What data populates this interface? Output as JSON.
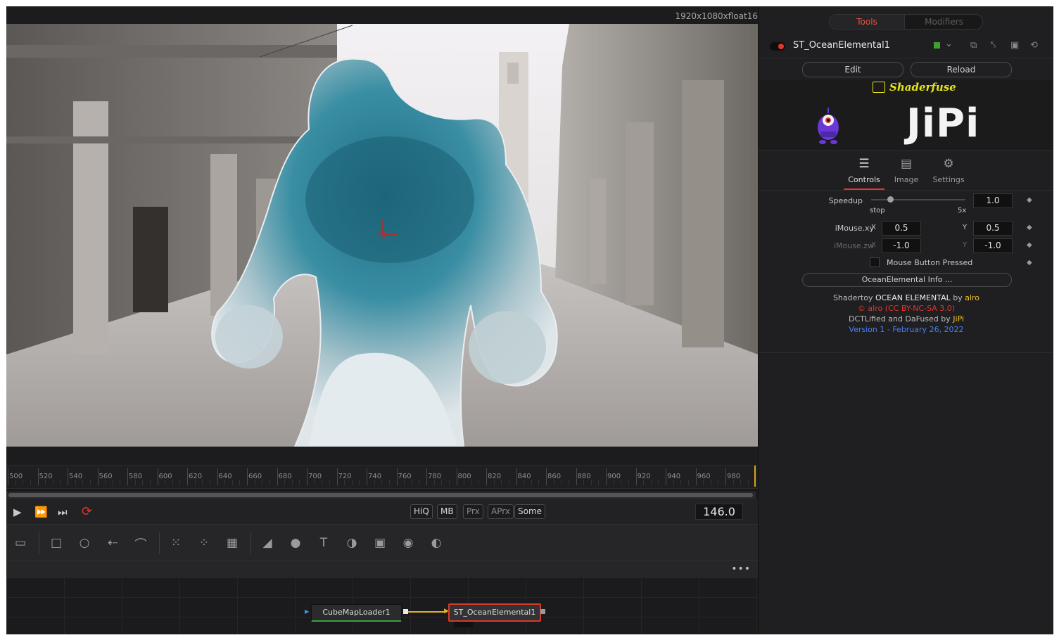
{
  "viewer": {
    "resolution": "1920x1080xfloat16"
  },
  "timeline": {
    "ticks": [
      "500",
      "520",
      "540",
      "560",
      "580",
      "600",
      "620",
      "640",
      "660",
      "680",
      "700",
      "720",
      "740",
      "760",
      "780",
      "800",
      "820",
      "840",
      "860",
      "880",
      "900",
      "920",
      "940",
      "960",
      "980"
    ],
    "current_frame": "146.0",
    "quality_buttons": [
      "HiQ",
      "MB",
      "Prx",
      "APrx",
      "Some"
    ]
  },
  "toolbar": {
    "icons": [
      "background-icon",
      "rectangle-icon",
      "ellipse-icon",
      "polygon-icon",
      "bspline-icon",
      "particle-emitter-icon",
      "particle-render-icon",
      "particle-icon",
      "image-plane-icon",
      "shape-3d-icon",
      "text-3d-icon",
      "merge-3d-icon",
      "renderer-3d-icon",
      "camera-3d-icon",
      "light-3d-icon"
    ]
  },
  "flow": {
    "more": "•••",
    "nodes": {
      "cubemap": "CubeMapLoader1",
      "ocean": "ST_OceanElemental1"
    }
  },
  "panel": {
    "tabs": {
      "tools": "Tools",
      "modifiers": "Modifiers"
    },
    "tool_name": "ST_OceanElemental1",
    "buttons": {
      "edit": "Edit",
      "reload": "Reload"
    },
    "shaderfuse": "Shaderfuse",
    "brand": "JiPi",
    "subtabs": {
      "controls": "Controls",
      "image": "Image",
      "settings": "Settings"
    },
    "controls": {
      "speedup_label": "Speedup",
      "speedup_value": "1.0",
      "speedup_min_label": "stop",
      "speedup_max_label": "5x",
      "speedup_level": 0.2,
      "imouse_xy_label": "iMouse.xy",
      "imouse_zw_label": "iMouse.zw",
      "x_label": "X",
      "y_label": "Y",
      "imouse_x": "0.5",
      "imouse_y": "0.5",
      "imouse_z": "-1.0",
      "imouse_w": "-1.0",
      "mouse_pressed_label": "Mouse Button Pressed",
      "info_button": "OceanElemental Info ..."
    },
    "info": {
      "line1_prefix": "Shadertoy ",
      "line1_title": "OCEAN ELEMENTAL",
      "line1_by": " by ",
      "line1_author": "alro",
      "line2": "© alro (CC BY-NC-SA 3.0)",
      "line3_prefix": "DCTLified and DaFused by ",
      "line3_author": "JiPi",
      "line4": "Version 1 - February 26, 2022"
    }
  },
  "colors": {
    "accent_red": "#e0372c",
    "tab_active": "#e8503f",
    "shaderfuse_yellow": "#e8e21a",
    "version_blue": "#4a7ef0",
    "link_orange": "#f0a02a"
  }
}
